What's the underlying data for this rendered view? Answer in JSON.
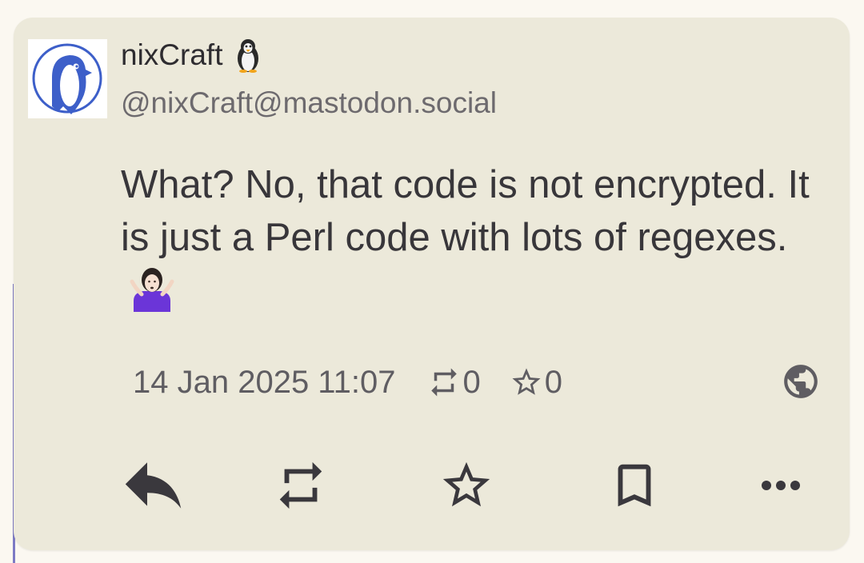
{
  "post": {
    "author": {
      "display_name": "nixCraft",
      "name_emoji": "penguin-icon",
      "handle": "@nixCraft@mastodon.social",
      "avatar": "penguin-avatar"
    },
    "content": {
      "text": "What? No, that code is not encrypted. It is just a Perl code with lots of regexes.",
      "emoji": "person-shrugging-icon"
    },
    "timestamp": "14 Jan 2025 11:07",
    "boost_count": "0",
    "favourite_count": "0",
    "visibility": "globe-icon"
  },
  "actions": [
    "reply-icon",
    "boost-icon",
    "favourite-icon",
    "bookmark-icon",
    "more-icon"
  ],
  "colors": {
    "card_background": "#ece9da",
    "page_background": "#fbf8f1",
    "text_primary": "#38363a",
    "text_secondary": "#6d6a6e",
    "thread_line": "#7d7bc4",
    "avatar_blue": "#3d5fc9"
  }
}
